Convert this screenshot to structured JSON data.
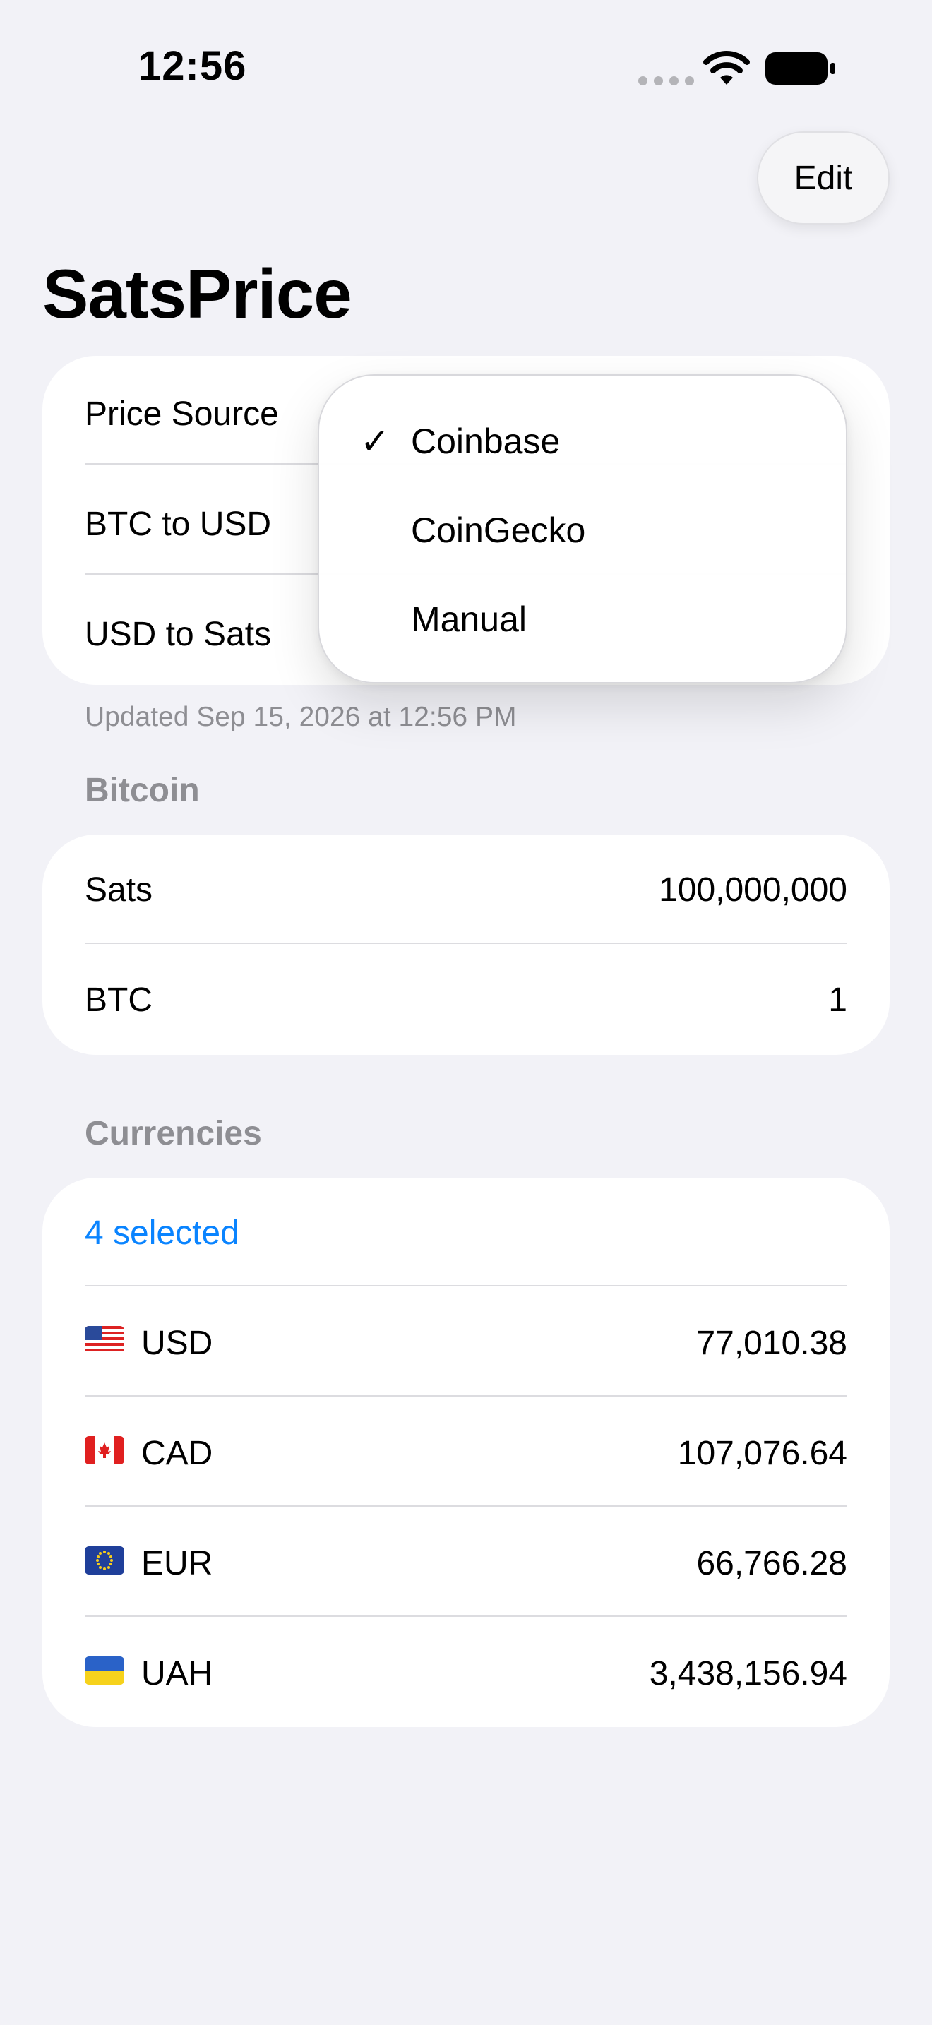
{
  "status_bar": {
    "time": "12:56"
  },
  "toolbar": {
    "edit_label": "Edit"
  },
  "title": "SatsPrice",
  "price_card": {
    "rows": [
      {
        "label": "Price Source"
      },
      {
        "label": "BTC to USD"
      },
      {
        "label": "USD to Sats"
      }
    ],
    "footer": "Updated Sep 15, 2026 at 12:56 PM"
  },
  "price_source_menu": {
    "selected": "Coinbase",
    "options": [
      {
        "label": "Coinbase",
        "checkmark": "✓"
      },
      {
        "label": "CoinGecko",
        "checkmark": ""
      },
      {
        "label": "Manual",
        "checkmark": ""
      }
    ]
  },
  "bitcoin_section": {
    "header": "Bitcoin",
    "rows": [
      {
        "label": "Sats",
        "value": "100,000,000"
      },
      {
        "label": "BTC",
        "value": "1"
      }
    ]
  },
  "currencies_section": {
    "header": "Currencies",
    "selected_label": "4 selected",
    "rows": [
      {
        "flag": "us-flag",
        "code": "USD",
        "value": "77,010.38"
      },
      {
        "flag": "ca-flag",
        "code": "CAD",
        "value": "107,076.64"
      },
      {
        "flag": "eu-flag",
        "code": "EUR",
        "value": "66,766.28"
      },
      {
        "flag": "ua-flag",
        "code": "UAH",
        "value": "3,438,156.94"
      }
    ]
  },
  "colors": {
    "background": "#f2f2f7",
    "card": "#ffffff",
    "accent": "#0a84ff",
    "secondary_text": "#8e8e93"
  }
}
